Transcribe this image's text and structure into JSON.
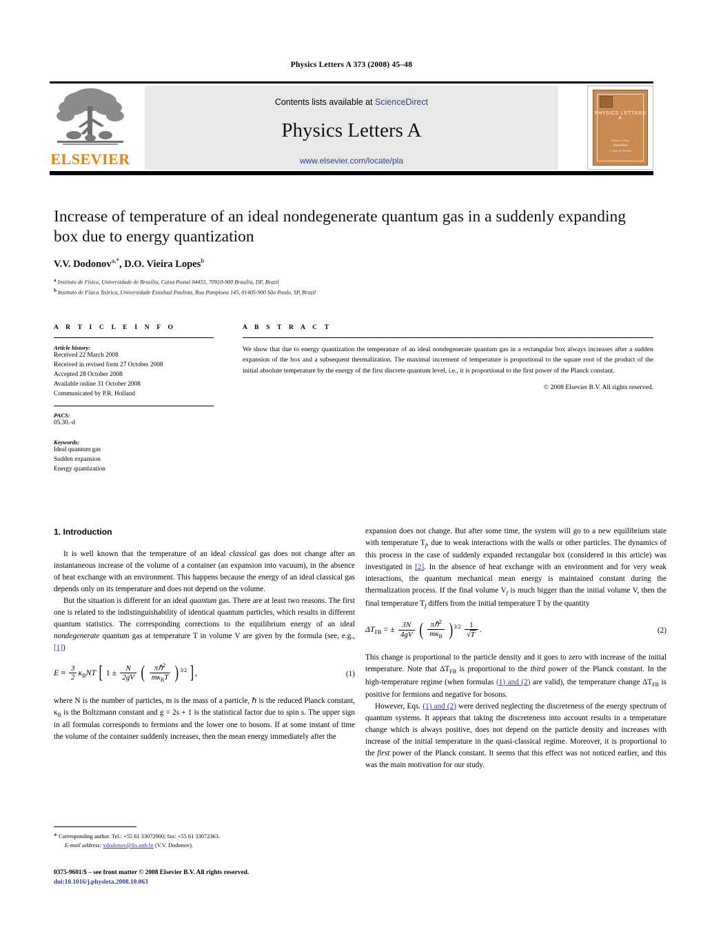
{
  "running_head": "Physics Letters A 373 (2008) 45–48",
  "masthead": {
    "contents_prefix": "Contents lists available at ",
    "sciencedirect": "ScienceDirect",
    "journal_title": "Physics Letters A",
    "journal_url": "www.elsevier.com/locate/pla",
    "publisher": "ELSEVIER",
    "cover": {
      "title": "PHYSICS LETTERS A",
      "foot_small": "Editors in Chief",
      "foot_names": "Stand Keil",
      "foot_sub": "J. Eisert, H. Kleinert",
      "url": "www.elsevier.com/locate/pla"
    },
    "accent_color": "#F08000",
    "link_color": "#2f3d8f",
    "banner_bg": "#e9e9e9"
  },
  "article": {
    "title": "Increase of temperature of an ideal nondegenerate quantum gas in a suddenly expanding box due to energy quantization",
    "authors_plain": "V.V. Dodonov",
    "author1": "V.V. Dodonov",
    "author1_marks": "a,*",
    "author2": ", D.O. Vieira Lopes",
    "author2_marks": "b",
    "affiliations": [
      {
        "mark": "a",
        "text": "Instituto de Física, Universidade de Brasília, Caixa Postal 04455, 70910-900 Brasília, DF, Brazil"
      },
      {
        "mark": "b",
        "text": "Instituto de Física Teórica, Universidade Estadual Paulista, Rua Pamplona 145, 01405-900 São Paulo, SP, Brazil"
      }
    ]
  },
  "info": {
    "heading": "A R T I C L E   I N F O",
    "history_label": "Article history:",
    "history": [
      "Received 22 March 2008",
      "Received in revised form 27 October 2008",
      "Accepted 28 October 2008",
      "Available online 31 October 2008",
      "Communicated by P.R. Holland"
    ],
    "pacs_label": "PACS:",
    "pacs": "05.30.-d",
    "keywords_label": "Keywords:",
    "keywords": [
      "Ideal quantum gas",
      "Sudden expansion",
      "Energy quantization"
    ]
  },
  "abstract": {
    "heading": "A B S T R A C T",
    "text": "We show that due to energy quantization the temperature of an ideal nondegenerate quantum gas in a rectangular box always increases after a sudden expansion of the box and a subsequent thermalization. The maximal increment of temperature is proportional to the square root of the product of the initial absolute temperature by the energy of the first discrete quantum level, i.e., it is proportional to the first power of the Planck constant.",
    "copyright": "© 2008 Elsevier B.V. All rights reserved."
  },
  "body": {
    "section1_title": "1. Introduction",
    "left": {
      "p1_a": "It is well known that the temperature of an ideal ",
      "p1_it": "classical",
      "p1_b": " gas does not change after an instantaneous increase of the volume of a container (an expansion into vacuum), in the absence of heat exchange with an environment. This happens because the energy of an ideal classical gas depends only on its temperature and does not depend on the volume.",
      "p2_a": "But the situation is different for an ideal ",
      "p2_it1": "quantum",
      "p2_b": " gas. There are at least two reasons. The first one is related to the indistinguishability of identical quantum particles, which results in different quantum statistics. The corresponding corrections to the equilibrium energy of an ideal ",
      "p2_it2": "nondegenerate",
      "p2_c": " quantum gas at temperature T in volume V are given by the formula (see, e.g., ",
      "p2_ref": "[1]",
      "p2_d": ")",
      "p3_a": "where N is the number of particles, m is the mass of a particle, ℏ is the reduced Planck constant, κ",
      "p3_b": " is the Boltzmann constant and g = 2s + 1 is the statistical factor due to spin s. The upper sign in all formulas corresponds to fermions and the lower one to bosons. If at some instant of time the volume of the container suddenly increases, then the mean energy immediately after the"
    },
    "right": {
      "p1_a": "expansion does not change. But after some time, the system will go to a new equilibrium state with temperature T",
      "p1_b": ", due to weak interactions with the walls or other particles. The dynamics of this process in the case of suddenly expanded rectangular box (considered in this article) was investigated in ",
      "p1_ref": "[2]",
      "p1_c": ". In the absence of heat exchange with an environment and for very weak interactions, the quantum mechanical mean energy is maintained constant during the thermalization process. If the final volume V",
      "p1_d": " is much bigger than the initial volume V, then the final temperature T",
      "p1_e": " differs from the initial temperature T by the quantity",
      "p2_a": "This change is proportional to the particle density and it goes to zero with increase of the initial temperature. Note that ΔT",
      "p2_b": " is proportional to the ",
      "p2_it": "third",
      "p2_c": " power of the Planck constant. In the high-temperature regime (when formulas ",
      "p2_ref1": "(1) and (2)",
      "p2_d": " are valid), the temperature change ΔT",
      "p2_e": " is positive for fermions and negative for bosons.",
      "p3_a": "However, Eqs. ",
      "p3_ref": "(1) and (2)",
      "p3_b": " were derived neglecting the discreteness of the energy spectrum of quantum systems. It appears that taking the discreteness into account results in a temperature change which is always positive, does not depend on the particle density and increases with increase of the initial temperature in the quasi-classical regime. Moreover, it is proportional to the ",
      "p3_it": "first",
      "p3_c": " power of the Planck constant. It seems that this effect was not noticed earlier, and this was the main motivation for our study."
    },
    "equations": {
      "eq1_number": "(1)",
      "eq1_latex": "E ≈ (3/2) κ_B N T [ 1 ± (N / 2gV) (π ℏ² / m κ_B T)^{3/2} ],",
      "eq2_number": "(2)",
      "eq2_latex": "ΔT_FB = ± (3N / 4gV) (π ℏ² / m κ_B)^{3/2} · 1/√T ."
    }
  },
  "footnotes": {
    "star": "*",
    "corresponding": "Corresponding author. Tel.: +55 61 33072900; fax: +55 61 33072363.",
    "email_label": "E-mail address:",
    "email": "vdodonov@fis.unb.br",
    "email_who": "(V.V. Dodonov).",
    "issn_line": "0375-9601/$ – see front matter © 2008 Elsevier B.V. All rights reserved.",
    "doi_line": "doi:10.1016/j.physleta.2008.10.063"
  }
}
